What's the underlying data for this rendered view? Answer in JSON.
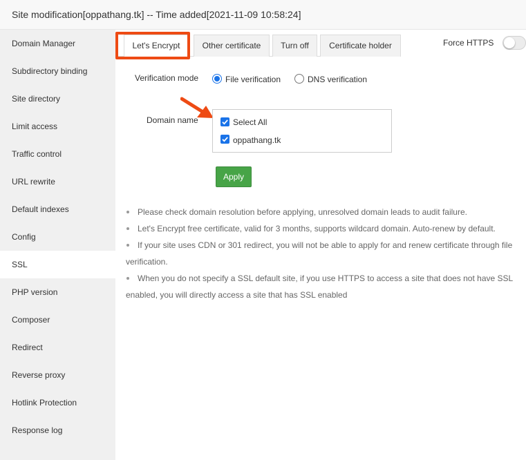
{
  "window": {
    "title": "Site modification[oppathang.tk] -- Time added[2021-11-09 10:58:24]"
  },
  "sidebar": {
    "items": [
      {
        "label": "Domain Manager"
      },
      {
        "label": "Subdirectory binding"
      },
      {
        "label": "Site directory"
      },
      {
        "label": "Limit access"
      },
      {
        "label": "Traffic control"
      },
      {
        "label": "URL rewrite"
      },
      {
        "label": "Default indexes"
      },
      {
        "label": "Config"
      },
      {
        "label": "SSL"
      },
      {
        "label": "PHP version"
      },
      {
        "label": "Composer"
      },
      {
        "label": "Redirect"
      },
      {
        "label": "Reverse proxy"
      },
      {
        "label": "Hotlink Protection"
      },
      {
        "label": "Response log"
      }
    ],
    "active_label": "SSL"
  },
  "tabs": [
    {
      "label": "Let's Encrypt"
    },
    {
      "label": "Other certificate"
    },
    {
      "label": "Turn off"
    },
    {
      "label": "Certificate holder"
    }
  ],
  "force_https": {
    "label": "Force HTTPS",
    "enabled": false
  },
  "verification": {
    "label": "Verification mode",
    "options": [
      {
        "label": "File verification",
        "checked": true
      },
      {
        "label": "DNS verification",
        "checked": false
      }
    ]
  },
  "domain": {
    "label": "Domain name",
    "options": [
      {
        "label": "Select All",
        "checked": true
      },
      {
        "label": "oppathang.tk",
        "checked": true
      }
    ]
  },
  "apply_label": "Apply",
  "notes": [
    "Please check domain resolution before applying, unresolved domain leads to audit failure.",
    "Let's Encrypt free certificate, valid for 3 months, supports wildcard domain. Auto-renew by default.",
    "If your site uses CDN or 301 redirect, you will not be able to apply for and renew certificate through file verification.",
    "When you do not specify a SSL default site, if you use HTTPS to access a site that does not have SSL enabled, you will directly access a site that has SSL enabled"
  ],
  "colors": {
    "highlight": "#ee4b14",
    "accent": "#1a73e8",
    "apply": "#47a447"
  }
}
